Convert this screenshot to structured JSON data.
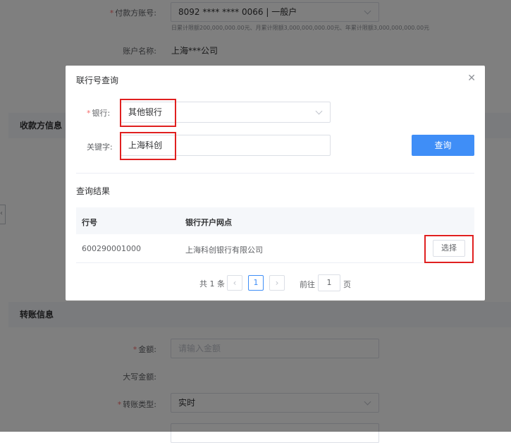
{
  "background": {
    "payer_account_label": "付款方账号:",
    "payer_account_value": "8092 **** **** 0066 | 一般户",
    "limits_text": "日累计限额200,000,000.00元、月累计限额3,000,000,000.00元、年累计限额3,000,000,000.00元",
    "account_name_label": "账户名称:",
    "account_name_value": "上海***公司",
    "payee_section_title": "收款方信息",
    "transfer_section_title": "转账信息",
    "amount_label": "金额:",
    "amount_placeholder": "请输入金额",
    "amount_caps_label": "大写金额:",
    "transfer_type_label": "转账类型:",
    "transfer_type_value": "实时"
  },
  "dialog": {
    "title": "联行号查询",
    "bank_label": "银行:",
    "bank_value": "其他银行",
    "keyword_label": "关键字:",
    "keyword_value": "上海科创",
    "query_button": "查询",
    "results_title": "查询结果",
    "table": {
      "columns": [
        "行号",
        "银行开户网点"
      ],
      "rows": [
        {
          "code": "600290001000",
          "branch": "上海科创银行有限公司",
          "action": "选择"
        }
      ]
    },
    "pagination": {
      "total_text": "共 1 条",
      "current_page": "1",
      "goto_label": "前往",
      "goto_value": "1",
      "page_suffix": "页"
    }
  },
  "colors": {
    "primary": "#3f8ef7",
    "highlight": "#e02020",
    "required": "#f56c6c"
  }
}
